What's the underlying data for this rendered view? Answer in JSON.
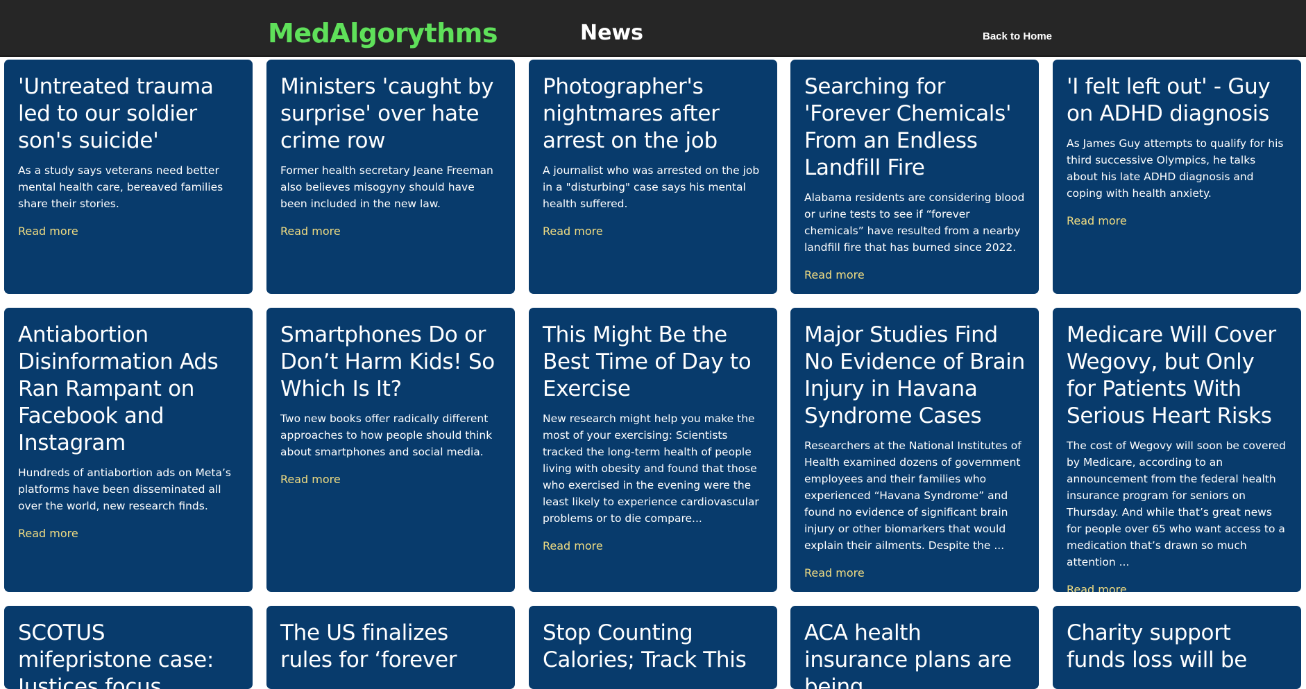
{
  "header": {
    "brand": "MedAlgorythms",
    "title": "News",
    "back_link": "Back to Home"
  },
  "read_more_label": "Read more",
  "articles": [
    {
      "title": "'Untreated trauma led to our soldier son's suicide'",
      "summary": "As a study says veterans need better mental health care, bereaved families share their stories."
    },
    {
      "title": "Ministers 'caught by surprise' over hate crime row",
      "summary": "Former health secretary Jeane Freeman also believes misogyny should have been included in the new law."
    },
    {
      "title": "Photographer's nightmares after arrest on the job",
      "summary": "A journalist who was arrested on the job in a \"disturbing\" case says his mental health suffered."
    },
    {
      "title": "Searching for 'Forever Chemicals' From an Endless Landfill Fire",
      "summary": "Alabama residents are considering blood or urine tests to see if “forever chemicals” have resulted from a nearby landfill fire that has burned since 2022."
    },
    {
      "title": "'I felt left out' - Guy on ADHD diagnosis",
      "summary": "As James Guy attempts to qualify for his third successive Olympics, he talks about his late ADHD diagnosis and coping with health anxiety."
    },
    {
      "title": "Antiabortion Disinformation Ads Ran Rampant on Facebook and Instagram",
      "summary": "Hundreds of antiabortion ads on Meta’s platforms have been disseminated all over the world, new research finds."
    },
    {
      "title": "Smartphones Do or Don’t Harm Kids! So Which Is It?",
      "summary": "Two new books offer radically different approaches to how people should think about smartphones and social media."
    },
    {
      "title": "This Might Be the Best Time of Day to Exercise",
      "summary": "New research might help you make the most of your exercising: Scientists tracked the long-term health of people living with obesity and found that those who exercised in the evening were the least likely to experience cardiovascular problems or to die compare..."
    },
    {
      "title": "Major Studies Find No Evidence of Brain Injury in Havana Syndrome Cases",
      "summary": "Researchers at the National Institutes of Health examined dozens of government employees and their families who experienced “Havana Syndrome” and found no evidence of significant brain injury or other biomarkers that would explain their ailments. Despite the ..."
    },
    {
      "title": "Medicare Will Cover Wegovy, but Only for Patients With Serious Heart Risks",
      "summary": "The cost of Wegovy will soon be covered by Medicare, according to an announcement from the federal health insurance program for seniors on Thursday. And while that’s great news for people over 65 who want access to a medication that’s drawn so much attention ..."
    },
    {
      "title": "SCOTUS mifepristone case: Justices focus",
      "summary": ""
    },
    {
      "title": "The US finalizes rules for ‘forever",
      "summary": ""
    },
    {
      "title": "Stop Counting Calories; Track This",
      "summary": ""
    },
    {
      "title": "ACA health insurance plans are being",
      "summary": ""
    },
    {
      "title": "Charity support funds loss will be",
      "summary": ""
    }
  ]
}
